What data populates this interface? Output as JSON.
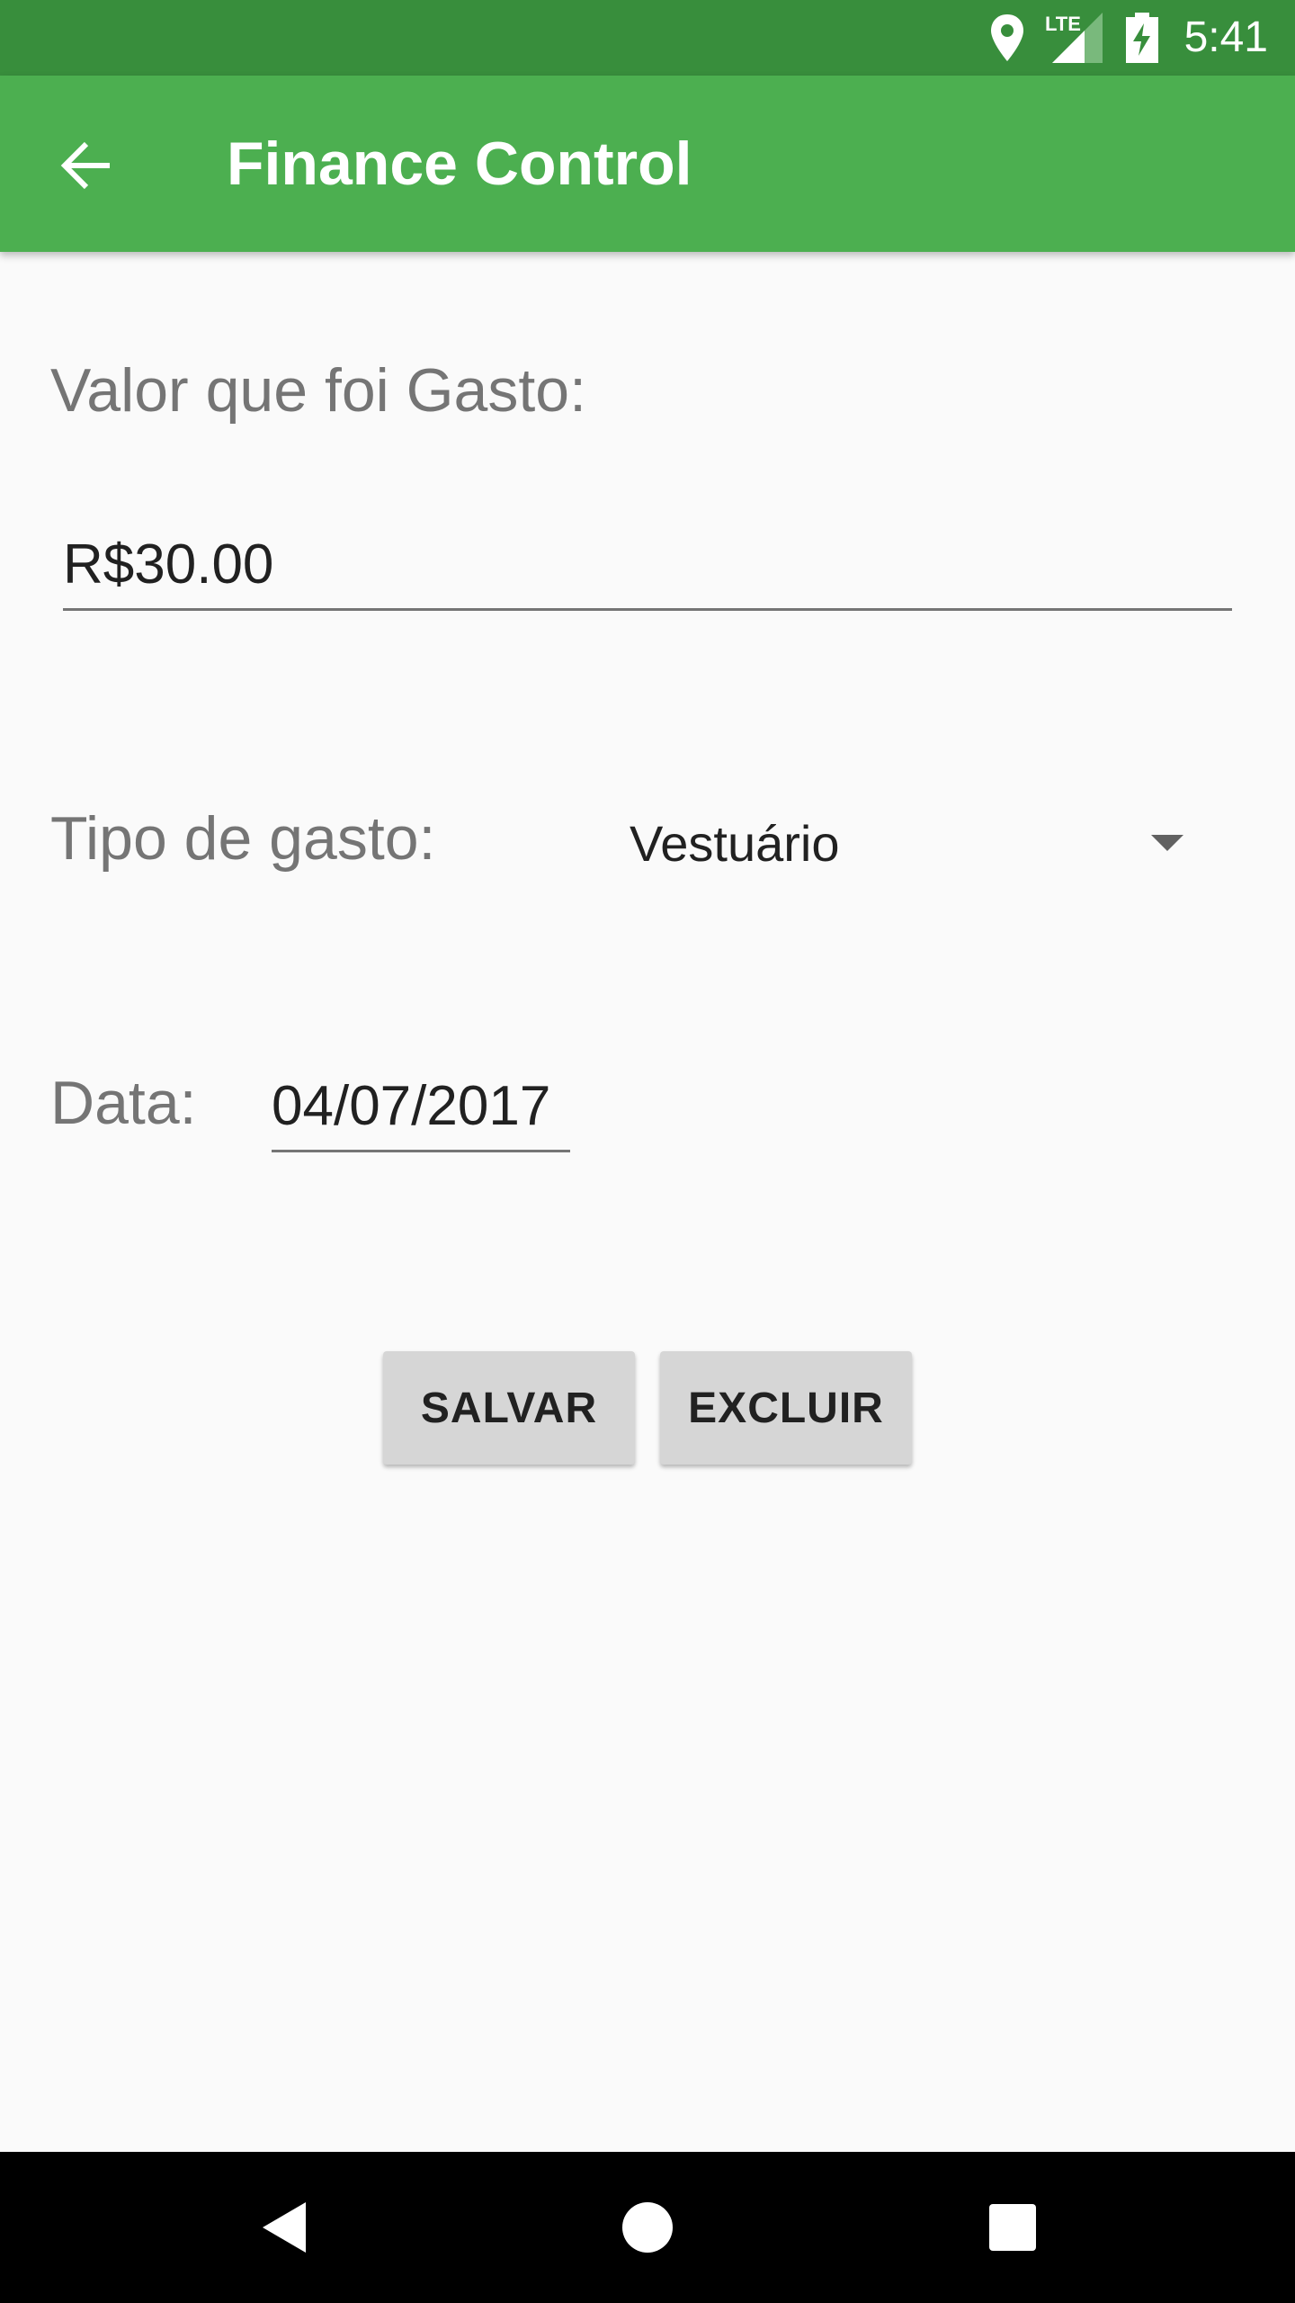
{
  "status_bar": {
    "time": "5:41",
    "network_label": "LTE",
    "icons": [
      "location-icon",
      "signal-icon",
      "battery-charging-icon"
    ]
  },
  "app_bar": {
    "title": "Finance Control",
    "back_icon": "arrow-back-icon",
    "background_color": "#4caf50",
    "status_color": "#388e3c"
  },
  "form": {
    "amount_label": "Valor que foi Gasto:",
    "amount_value": "R$30.00",
    "type_label": "Tipo de gasto:",
    "type_selected": "Vestuário",
    "date_label": "Data:",
    "date_value": "04/07/2017"
  },
  "actions": {
    "save_label": "SALVAR",
    "delete_label": "EXCLUIR"
  },
  "nav_bar": {
    "icons": [
      "back-triangle-icon",
      "home-circle-icon",
      "recents-square-icon"
    ]
  }
}
